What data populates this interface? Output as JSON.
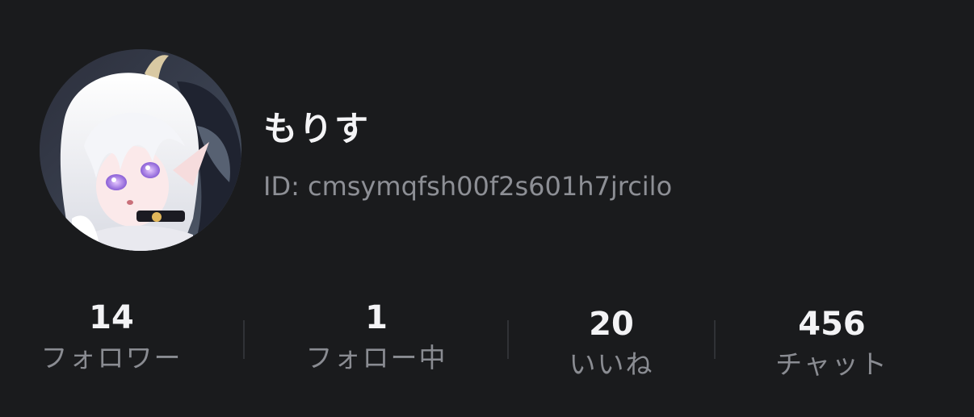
{
  "profile": {
    "display_name": "もりす",
    "user_id": "ID: cmsymqfsh00f2s601h7jrcilo",
    "avatar": "anime-character-avatar"
  },
  "stats": [
    {
      "value": "14",
      "label": "フォロワー"
    },
    {
      "value": "1",
      "label": "フォロー中"
    },
    {
      "value": "20",
      "label": "いいね"
    },
    {
      "value": "456",
      "label": "チャット"
    }
  ],
  "colors": {
    "background": "#1a1b1d",
    "text_primary": "#f4f4f6",
    "text_secondary": "#8d8f95",
    "divider": "#303236"
  }
}
